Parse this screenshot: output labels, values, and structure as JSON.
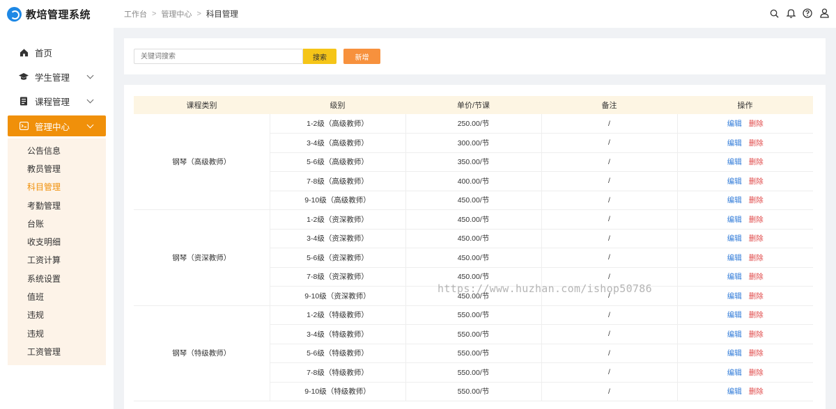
{
  "app": {
    "title": "教培管理系统"
  },
  "breadcrumb": [
    "工作台",
    "管理中心",
    "科目管理"
  ],
  "sidebar": {
    "items": [
      {
        "label": "首页",
        "icon": "home-icon"
      },
      {
        "label": "学生管理",
        "icon": "graduation-cap-icon"
      },
      {
        "label": "课程管理",
        "icon": "document-icon"
      },
      {
        "label": "管理中心",
        "icon": "management-icon"
      }
    ],
    "submenu": [
      "公告信息",
      "教员管理",
      "科目管理",
      "考勤管理",
      "台账",
      "收支明细",
      "工资计算",
      "系统设置",
      "值班",
      "违规",
      "违规",
      "工资管理"
    ]
  },
  "search": {
    "placeholder": "关键词搜索",
    "search_label": "搜索",
    "add_label": "新增"
  },
  "table": {
    "columns": [
      "课程类别",
      "级别",
      "单价/节课",
      "备注",
      "操作"
    ],
    "edit_label": "编辑",
    "delete_label": "删除",
    "groups": [
      {
        "category": "钢琴（高级教师）",
        "rows": [
          {
            "level": "1-2级（高级教师）",
            "price": "250.00/节",
            "note": "/"
          },
          {
            "level": "3-4级（高级教师）",
            "price": "300.00/节",
            "note": "/"
          },
          {
            "level": "5-6级（高级教师）",
            "price": "350.00/节",
            "note": "/"
          },
          {
            "level": "7-8级（高级教师）",
            "price": "400.00/节",
            "note": "/"
          },
          {
            "level": "9-10级（高级教师）",
            "price": "450.00/节",
            "note": "/"
          }
        ]
      },
      {
        "category": "钢琴（资深教师）",
        "rows": [
          {
            "level": "1-2级（资深教师）",
            "price": "450.00/节",
            "note": "/"
          },
          {
            "level": "3-4级（资深教师）",
            "price": "450.00/节",
            "note": "/"
          },
          {
            "level": "5-6级（资深教师）",
            "price": "450.00/节",
            "note": "/"
          },
          {
            "level": "7-8级（资深教师）",
            "price": "450.00/节",
            "note": "/"
          },
          {
            "level": "9-10级（资深教师）",
            "price": "450.00/节",
            "note": "/"
          }
        ]
      },
      {
        "category": "钢琴（特级教师）",
        "rows": [
          {
            "level": "1-2级（特级教师）",
            "price": "550.00/节",
            "note": "/"
          },
          {
            "level": "3-4级（特级教师）",
            "price": "550.00/节",
            "note": "/"
          },
          {
            "level": "5-6级（特级教师）",
            "price": "550.00/节",
            "note": "/"
          },
          {
            "level": "7-8级（特级教师）",
            "price": "550.00/节",
            "note": "/"
          },
          {
            "level": "9-10级（特级教师）",
            "price": "550.00/节",
            "note": "/"
          }
        ]
      }
    ]
  },
  "watermark": "https://www.huzhan.com/ishop50786",
  "colors": {
    "accent": "#f0900a",
    "search_button": "#f5c518",
    "add_button": "#f7913d",
    "edit": "#2f7ad8",
    "delete": "#e04a4a"
  }
}
